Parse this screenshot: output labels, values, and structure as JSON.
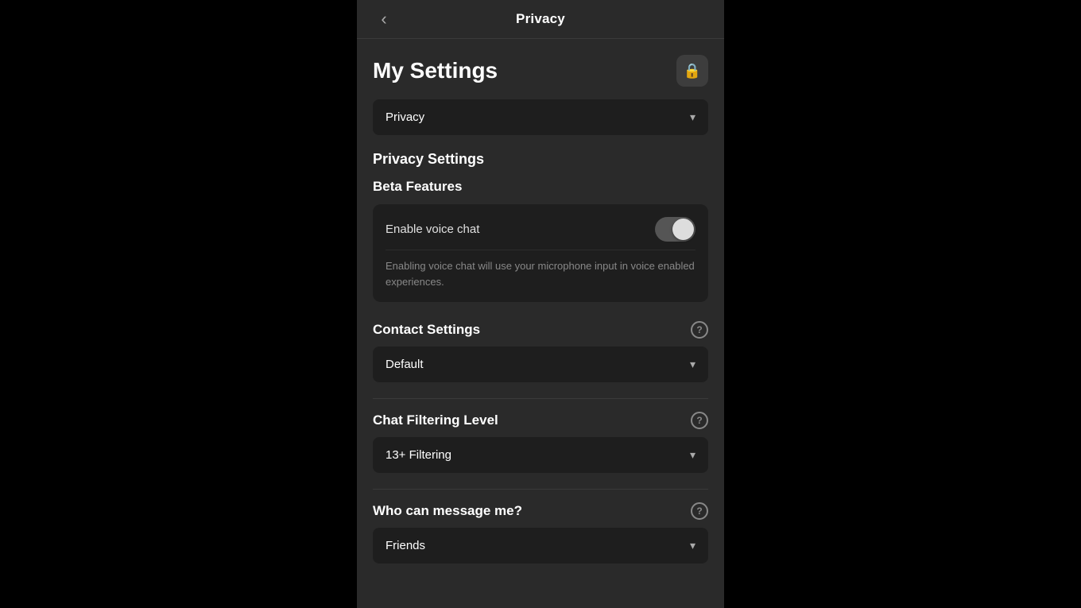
{
  "nav": {
    "back_label": "‹",
    "title": "Privacy"
  },
  "header": {
    "title": "My Settings",
    "lock_icon": "🔒"
  },
  "category_dropdown": {
    "value": "Privacy",
    "chevron": "▾"
  },
  "privacy_settings": {
    "heading": "Privacy Settings"
  },
  "beta_features": {
    "heading": "Beta Features",
    "toggle_label": "Enable voice chat",
    "description": "Enabling voice chat will use your microphone input in voice enabled experiences.",
    "toggle_on": true
  },
  "contact_settings": {
    "heading": "Contact Settings",
    "value": "Default",
    "chevron": "▾"
  },
  "chat_filtering": {
    "heading": "Chat Filtering Level",
    "value": "13+ Filtering",
    "chevron": "▾"
  },
  "who_can_message": {
    "heading": "Who can message me?",
    "value": "Friends",
    "chevron": "▾"
  }
}
